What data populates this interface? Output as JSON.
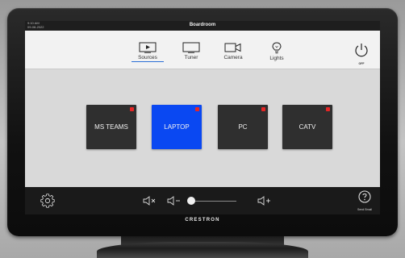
{
  "status": {
    "time": "9:10 AM",
    "date": "09-08-2022",
    "room_name": "Boardroom"
  },
  "nav": {
    "tabs": [
      {
        "label": "Sources",
        "icon": "display-play-icon",
        "active": true
      },
      {
        "label": "Tuner",
        "icon": "tv-monitor-icon",
        "active": false
      },
      {
        "label": "Camera",
        "icon": "video-camera-icon",
        "active": false
      },
      {
        "label": "Lights",
        "icon": "light-bulb-icon",
        "active": false
      }
    ],
    "power_label": "OFF"
  },
  "sources": [
    {
      "label": "MS TEAMS",
      "selected": false
    },
    {
      "label": "LAPTOP",
      "selected": true
    },
    {
      "label": "PC",
      "selected": false
    },
    {
      "label": "CATV",
      "selected": false
    }
  ],
  "bottom_bar": {
    "volume_level": 0.0,
    "help_label": "Send Email"
  },
  "brand": "CRESTRON",
  "colors": {
    "accent": "#2b6fd6",
    "selected_source": "#0a48f2",
    "source_tile": "#2f2f2f",
    "status_dot": "#e62626"
  }
}
